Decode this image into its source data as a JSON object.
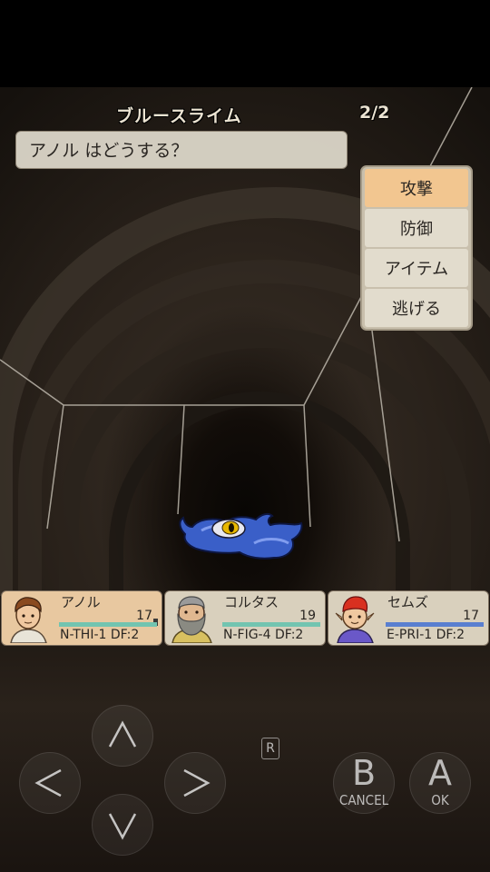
{
  "battle": {
    "enemy_name": "ブルースライム",
    "page_indicator": "2/2",
    "message": "アノル はどうする？"
  },
  "commands": [
    "攻撃",
    "防御",
    "アイテム",
    "逃げる"
  ],
  "selected_command": "攻撃",
  "party": [
    {
      "name": "アノル",
      "hp": "17",
      "status": "N-THI-1 DF:2",
      "active": true,
      "hp_bar_color": "#72c4b0"
    },
    {
      "name": "コルタス",
      "hp": "19",
      "status": "N-FIG-4 DF:2",
      "active": false,
      "hp_bar_color": "#72c4b0"
    },
    {
      "name": "セムズ",
      "hp": "17",
      "status": "E-PRI-1 DF:2",
      "active": false,
      "hp_bar_color": "#5a7fd0"
    }
  ],
  "controls": {
    "dpad": [
      "up-arrow-icon",
      "left-arrow-icon",
      "right-arrow-icon",
      "down-arrow-icon"
    ],
    "r_label": "R",
    "b": {
      "letter": "B",
      "label": "CANCEL"
    },
    "a": {
      "letter": "A",
      "label": "OK"
    }
  },
  "colors": {
    "selected_command": "#f2c690",
    "active_party_card": "#e8c8a0",
    "party_card": "#d9d0bd",
    "message_box": "#e0dacc"
  }
}
